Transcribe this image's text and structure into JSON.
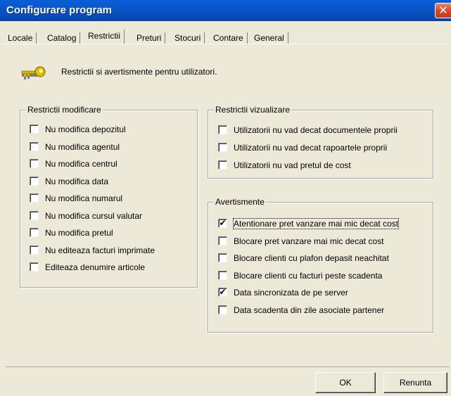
{
  "window": {
    "title": "Configurare program",
    "close_glyph": "✕"
  },
  "tabs": [
    {
      "label": "Locale",
      "active": false
    },
    {
      "label": "Catalog",
      "active": false
    },
    {
      "label": "Restrictii",
      "active": true
    },
    {
      "label": "Preturi",
      "active": false
    },
    {
      "label": "Stocuri",
      "active": false
    },
    {
      "label": "Contare",
      "active": false
    },
    {
      "label": "General",
      "active": false
    }
  ],
  "header": {
    "icon": "key-icon",
    "text": "Restrictii si avertismente pentru utilizatori."
  },
  "restrictii_modificare": {
    "title": "Restrictii modificare",
    "items": [
      {
        "label": "Nu modifica depozitul",
        "checked": false
      },
      {
        "label": "Nu modifica agentul",
        "checked": false
      },
      {
        "label": "Nu modifica centrul",
        "checked": false
      },
      {
        "label": "Nu modifica data",
        "checked": false
      },
      {
        "label": "Nu modifica numarul",
        "checked": false
      },
      {
        "label": "Nu modifica cursul valutar",
        "checked": false
      },
      {
        "label": "Nu modifica pretul",
        "checked": false
      },
      {
        "label": "Nu editeaza facturi imprimate",
        "checked": false
      },
      {
        "label": "Editeaza denumire articole",
        "checked": false
      }
    ]
  },
  "restrictii_vizualizare": {
    "title": "Restrictii vizualizare",
    "items": [
      {
        "label": "Utilizatorii nu vad decat documentele proprii",
        "checked": false
      },
      {
        "label": "Utilizatorii nu vad decat rapoartele proprii",
        "checked": false
      },
      {
        "label": "Utilizatorii nu vad pretul de cost",
        "checked": false
      }
    ]
  },
  "avertismente": {
    "title": "Avertismente",
    "items": [
      {
        "label": "Atentionare pret vanzare mai mic decat cost",
        "checked": true,
        "focused": true
      },
      {
        "label": "Blocare pret vanzare mai mic decat cost",
        "checked": false
      },
      {
        "label": "Blocare clienti cu plafon depasit neachitat",
        "checked": false
      },
      {
        "label": "Blocare clienti cu facturi peste scadenta",
        "checked": false
      },
      {
        "label": "Data sincronizata de pe server",
        "checked": true
      },
      {
        "label": "Data scadenta din zile asociate partener",
        "checked": false
      }
    ]
  },
  "buttons": {
    "ok": "OK",
    "cancel": "Renunta"
  },
  "colors": {
    "dialog_bg": "#ece9d8",
    "titlebar": "#0855c9",
    "close": "#d5452a"
  }
}
